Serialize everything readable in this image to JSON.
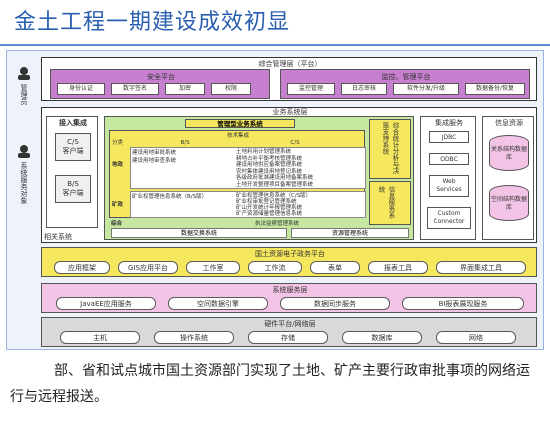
{
  "page": {
    "title": "金土工程一期建设成效初显"
  },
  "colors": {
    "title_text": "#2a5fb0",
    "purple_band": "#c77fcf",
    "yellow_band": "#f6e85e",
    "pink_band": "#f3c4e6",
    "grey_band": "#d9d9d9",
    "green_band": "#c6e7a0"
  },
  "diagram": {
    "left_labels": {
      "admin": "管理员",
      "service_obj": "系统服务对象"
    },
    "top": {
      "title": "综合管理层（平台）",
      "security": {
        "title": "安全平台",
        "items": [
          "身份认证",
          "数字签名",
          "加密",
          "权限"
        ]
      },
      "monitor": {
        "title": "监控、管理平台",
        "items": [
          "监控管理",
          "日志审核",
          "软件分发/升级",
          "数据备份/恢复"
        ]
      }
    },
    "business": {
      "title": "业务系统层",
      "access": {
        "title": "接入集成",
        "cs": "C/S\n客户端",
        "bs": "B/S\n客户端",
        "related": "相关系统"
      },
      "core": {
        "title": "管理型业务系统",
        "header_bs": "B/S",
        "header_cs": "C/S",
        "tech": "技术集成",
        "col_fenlei": "分类",
        "col_land": "地政",
        "col_mine": "矿政",
        "col_zonghe": "综合",
        "land_left": [
          "建设用地审批系统",
          "建设用地审查系统"
        ],
        "land_right": [
          "土地利用计划管理系统",
          "耕地占补平衡考核管理系统",
          "建设用地供应备案管理系统",
          "农村集体建设用地登记系统",
          "各级政府批准建设用地备案系统",
          "土地开发整理项目备案管理系统"
        ],
        "mine_left": [
          "矿业权管理信息系统（B/S版）"
        ],
        "mine_right": [
          "矿业权管理信息系统（C/S版）",
          "矿业权审批登记管理系统",
          "矿山开发统计年报管理系统",
          "矿产资源储量管理信息系统"
        ],
        "zonghe_left": "执法监察管理系统",
        "exchange": "数据交换系统",
        "resource_mgmt": "资源管理系统",
        "side_stats": "综合统计分析与决策支持系统",
        "side_info": "信息服务系统"
      },
      "integration": {
        "title": "集成服务",
        "items": [
          "JDBC",
          "ODBC",
          "Web\nServices",
          "Custom\nConnector"
        ]
      },
      "info_res": {
        "title": "信息资源",
        "db1": "关系结构数据库",
        "db2": "空间结构数据库"
      }
    },
    "egov": {
      "title": "国土资源电子政务平台",
      "items": [
        "应用框架",
        "GIS应用平台",
        "工作室",
        "工作流",
        "表单",
        "报表工具",
        "界面集成工具"
      ]
    },
    "sysservice": {
      "title": "系统服务层",
      "items": [
        "JavaEE应用服务",
        "空间数据引擎",
        "数据同步服务",
        "BI报表展现服务"
      ]
    },
    "hardware": {
      "title": "硬件平台/网络层",
      "items": [
        "主机",
        "操作系统",
        "存储",
        "数据库",
        "网络"
      ]
    }
  },
  "caption": "部、省和试点城市国土资源部门实现了土地、矿产主要行政审批事项的网络运行与远程报送。"
}
